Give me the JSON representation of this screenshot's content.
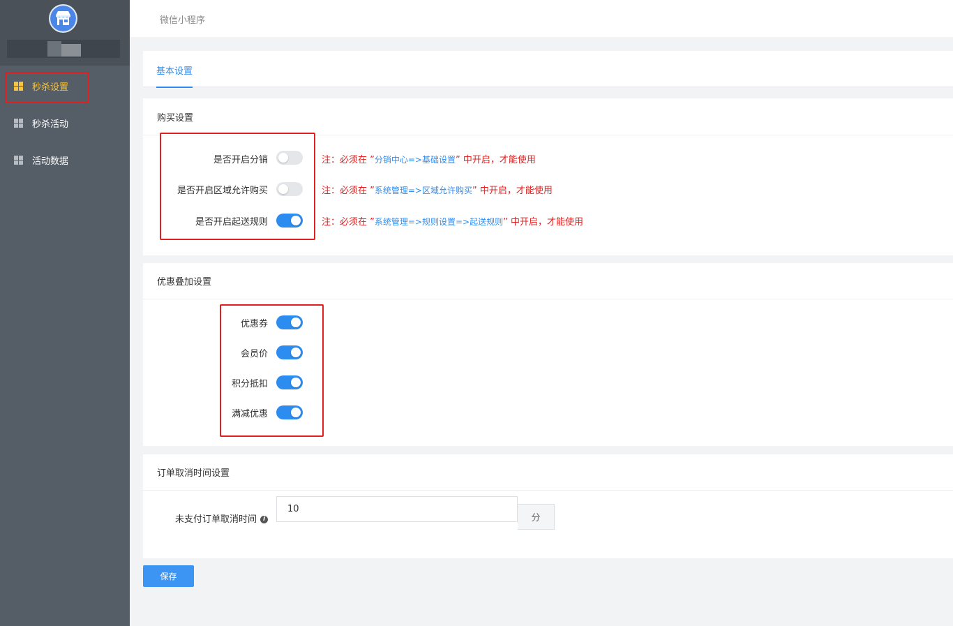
{
  "sidebar": {
    "items": [
      {
        "label": "秒杀设置",
        "active": true
      },
      {
        "label": "秒杀活动",
        "active": false
      },
      {
        "label": "活动数据",
        "active": false
      }
    ]
  },
  "topbar": {
    "breadcrumb": "微信小程序"
  },
  "tabs": [
    {
      "label": "基本设置",
      "active": true
    }
  ],
  "purchase": {
    "title": "购买设置",
    "rows": [
      {
        "label": "是否开启分销",
        "on": false,
        "note_prefix": "注：必须在 ”",
        "note_path": "分销中心=>基础设置",
        "note_suffix": "” 中开启，才能使用"
      },
      {
        "label": "是否开启区域允许购买",
        "on": false,
        "note_prefix": "注：必须在 ”",
        "note_path": "系统管理=>区域允许购买",
        "note_suffix": "” 中开启，才能使用"
      },
      {
        "label": "是否开启起送规则",
        "on": true,
        "note_prefix": "注：必须在 ”",
        "note_path": "系统管理=>规则设置=>起送规则",
        "note_suffix": "” 中开启，才能使用"
      }
    ]
  },
  "discount": {
    "title": "优惠叠加设置",
    "rows": [
      {
        "label": "优惠券",
        "on": true
      },
      {
        "label": "会员价",
        "on": true
      },
      {
        "label": "积分抵扣",
        "on": true
      },
      {
        "label": "满减优惠",
        "on": true
      }
    ]
  },
  "cancel": {
    "title": "订单取消时间设置",
    "label": "未支付订单取消时间",
    "info_icon": "i",
    "value": "10",
    "unit": "分"
  },
  "save_label": "保存",
  "colors": {
    "accent": "#2d8cf0",
    "warning": "#e02020",
    "active_nav": "#f6c343"
  }
}
